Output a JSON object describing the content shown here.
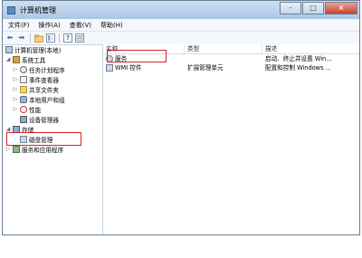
{
  "window": {
    "title": "计算机管理",
    "controls": [
      "-",
      "□",
      "×"
    ]
  },
  "menubar": {
    "items": [
      "文件(F)",
      "操作(A)",
      "查看(V)",
      "帮助(H)"
    ]
  },
  "toolbar": {
    "icons": [
      "back-arrow-icon",
      "forward-arrow-icon",
      "up-folder-icon",
      "show-tree-icon",
      "help-icon",
      "properties-icon"
    ],
    "back": "⬅",
    "forward": "➡",
    "help": "?"
  },
  "tree": {
    "root": "计算机管理(本地)",
    "system_tools": "系统工具",
    "task_scheduler": "任务计划程序",
    "event_viewer": "事件查看器",
    "shared_folders": "共享文件夹",
    "local_users": "本地用户和组",
    "performance": "性能",
    "device_manager": "设备管理器",
    "storage": "存储",
    "disk_management": "磁盘管理",
    "services_apps": "服务和应用程序"
  },
  "list": {
    "columns": [
      "名称",
      "类型",
      "描述"
    ],
    "rows": [
      {
        "name": "服务",
        "type": "",
        "desc": "启动、终止并设置 Win..."
      },
      {
        "name": "WMI 控件",
        "type": "扩展管理单元",
        "desc": "配置和控制 Windows ..."
      }
    ]
  },
  "highlight_color": "#d6232b"
}
